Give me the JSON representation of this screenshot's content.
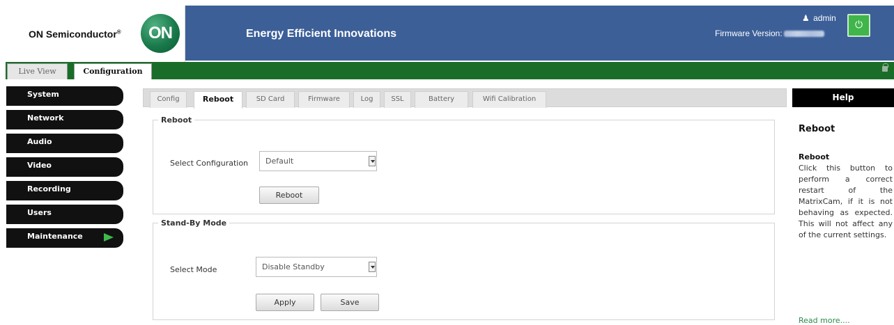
{
  "header": {
    "brand": "ON Semiconductor",
    "brand_mark": "®",
    "logo_text": "ON",
    "tagline": "Energy Efficient Innovations",
    "user": "admin",
    "firmware_label": "Firmware Version:"
  },
  "main_tabs": [
    {
      "label": "Live View"
    },
    {
      "label": "Configuration"
    }
  ],
  "sidebar": {
    "items": [
      {
        "label": "System"
      },
      {
        "label": "Network"
      },
      {
        "label": "Audio"
      },
      {
        "label": "Video"
      },
      {
        "label": "Recording"
      },
      {
        "label": "Users"
      },
      {
        "label": "Maintenance"
      }
    ]
  },
  "sub_tabs": [
    {
      "label": "Config"
    },
    {
      "label": "Reboot"
    },
    {
      "label": "SD Card"
    },
    {
      "label": "Firmware"
    },
    {
      "label": "Log"
    },
    {
      "label": "SSL"
    },
    {
      "label": "Battery"
    },
    {
      "label": "Wifi Calibration"
    }
  ],
  "reboot_section": {
    "legend": "Reboot",
    "select_label": "Select Configuration",
    "select_value": "Default",
    "button": "Reboot"
  },
  "standby_section": {
    "legend": "Stand-By Mode",
    "select_label": "Select Mode",
    "select_value": "Disable Standby",
    "apply_button": "Apply",
    "save_button": "Save"
  },
  "help": {
    "header": "Help",
    "title": "Reboot",
    "subtitle": "Reboot",
    "body": "Click this button to perform a correct restart of the MatrixCam, if it is not behaving as expected. This will not affect any of the current settings.",
    "link": "Read more...."
  },
  "colors": {
    "header_blue": "#3c5f98",
    "tab_bar_green": "#1a6d28",
    "sidebar_black": "#111111",
    "accent_green": "#3dbb4a"
  },
  "icons": [
    "user-icon",
    "power-icon",
    "lock-icon",
    "chevron-right-icon",
    "dropdown-arrow-icon"
  ]
}
